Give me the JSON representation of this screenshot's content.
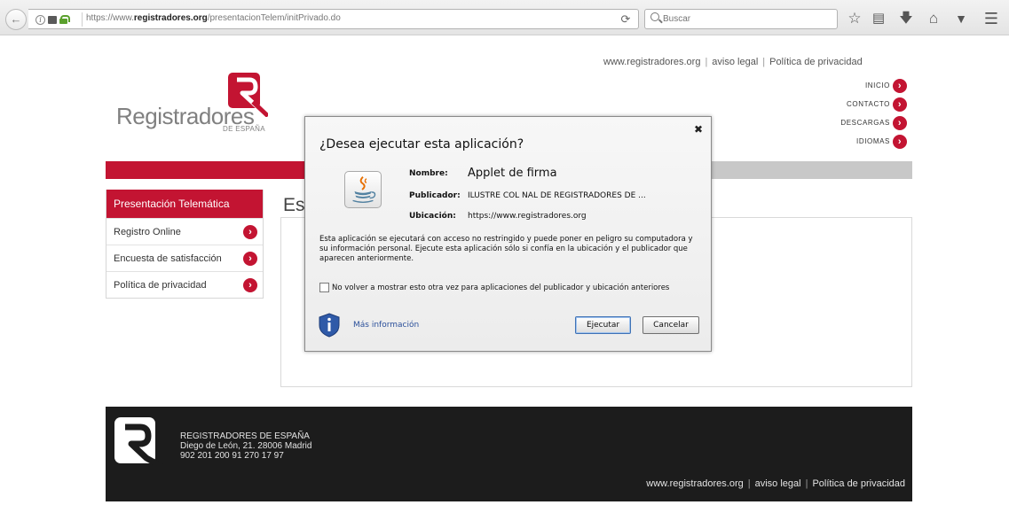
{
  "browser": {
    "url_prefix": "https://www.",
    "url_domain": "registradores.org",
    "url_path": "/presentacionTelem/initPrivado.do",
    "search_placeholder": "Buscar"
  },
  "header": {
    "top_links": [
      "www.registradores.org",
      "aviso legal",
      "Política de privacidad"
    ],
    "logo_name": "Registradores",
    "logo_sub": "DE ESPAÑA",
    "nav": [
      "INICIO",
      "CONTACTO",
      "DESCARGAS",
      "IDIOMAS"
    ]
  },
  "sidebar": {
    "title": "Presentación Telemática",
    "items": [
      "Registro Online",
      "Encuesta de satisfacción",
      "Política de privacidad"
    ]
  },
  "content": {
    "title_visible": "Es"
  },
  "footer": {
    "org": "REGISTRADORES DE ESPAÑA",
    "address": "Diego de León, 21. 28006 Madrid",
    "phones": "902 201 200 91 270 17 97",
    "links": [
      "www.registradores.org",
      "aviso legal",
      "Política de privacidad"
    ]
  },
  "dialog": {
    "title": "¿Desea ejecutar esta aplicación?",
    "name_label": "Nombre:",
    "name_value": "Applet de firma",
    "publisher_label": "Publicador:",
    "publisher_value": "ILUSTRE COL NAL DE REGISTRADORES DE ...",
    "location_label": "Ubicación:",
    "location_value": "https://www.registradores.org",
    "warning": "Esta aplicación se ejecutará con acceso no restringido y puede poner en peligro su computadora y su información personal. Ejecute esta aplicación sólo si confía en la ubicación y el publicador que aparecen anteriormente.",
    "checkbox_label": "No volver a mostrar esto otra vez para aplicaciones del publicador y ubicación anteriores",
    "more_info": "Más información",
    "run_button": "Ejecutar",
    "cancel_button": "Cancelar"
  },
  "colors": {
    "brand_red": "#c31432",
    "footer_bg": "#1c1c1c",
    "link_blue": "#2a4f9a"
  }
}
